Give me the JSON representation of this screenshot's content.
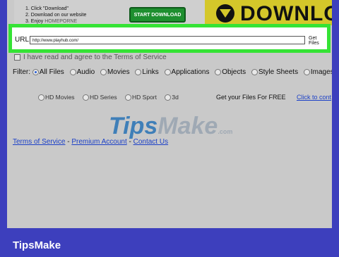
{
  "steps": [
    "1. Click \"Download\"",
    "2. Download on our website",
    "3. Enjoy"
  ],
  "steps_extra": "HOMEPORNE",
  "start_button": "START DOWNLOAD",
  "banner_text": "DOWNLOA",
  "url_label": "URL:",
  "url_value": "http://www.playhub.com/",
  "get_files": "Get Files",
  "agree_text": "I have read and agree to the Terms of Service",
  "filter_label": "Filter:",
  "filters": [
    "All Files",
    "Audio",
    "Movies",
    "Links",
    "Applications",
    "Objects",
    "Style Sheets",
    "Images"
  ],
  "categories": [
    "HD Movies",
    "HD Series",
    "HD Sport",
    "3d"
  ],
  "free_text": "Get your Files For FREE",
  "contact_link": "Click to cont",
  "watermark": {
    "main": "Tips",
    "rest": "Make",
    "suffix": ".com"
  },
  "footer": {
    "terms": "Terms of Service",
    "sep1": " - ",
    "premium": "Premium Account",
    "sep2": " - ",
    "contact": "Contact Us"
  },
  "brand": "TipsMake",
  "colors": {
    "frame": "#3d3fbd",
    "highlight": "#35e335",
    "page": "#c9c9c9",
    "banner": "#d4c72a",
    "link": "#1a3fc7"
  }
}
